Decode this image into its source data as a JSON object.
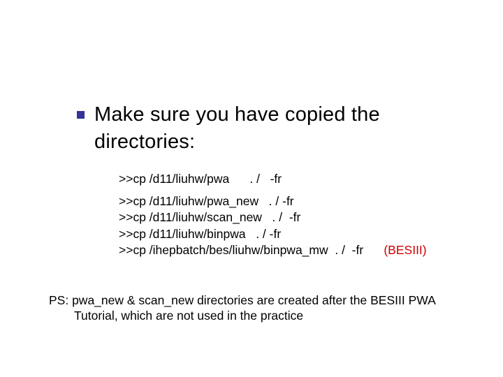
{
  "headline": "Make sure you have copied the directories:",
  "commands": {
    "line1": ">>cp /d11/liuhw/pwa      . /   -fr",
    "line2": ">>cp /d11/liuhw/pwa_new   . / -fr",
    "line3": ">>cp /d11/liuhw/scan_new   . /  -fr",
    "line4": ">>cp /d11/liuhw/binpwa   . / -fr",
    "line5a": ">>cp /ihepbatch/bes/liuhw/binpwa_mw  . /  -fr      ",
    "line5b": "(BESIII)"
  },
  "ps": "PS: pwa_new & scan_new directories are created after the BESIII PWA Tutorial, which are not used in the practice"
}
